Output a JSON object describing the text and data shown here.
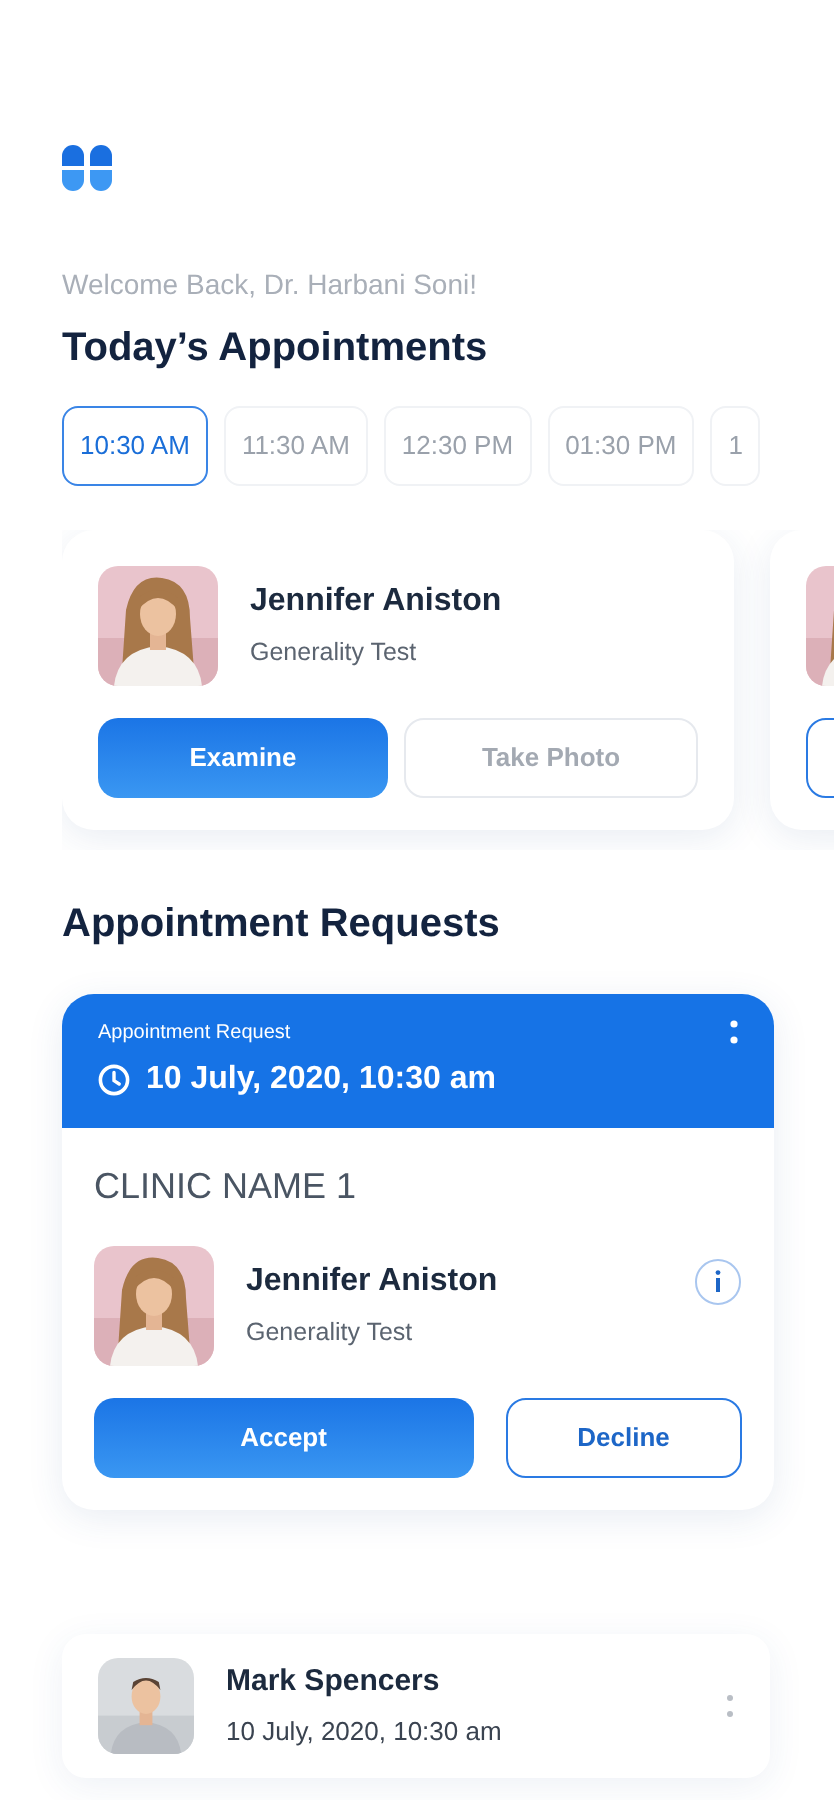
{
  "greeting": "Welcome Back, Dr. Harbani Soni!",
  "todays_title": "Today’s Appointments",
  "time_slots": [
    {
      "label": "10:30 AM",
      "selected": true
    },
    {
      "label": "11:30 AM",
      "selected": false
    },
    {
      "label": "12:30 PM",
      "selected": false
    },
    {
      "label": "01:30 PM",
      "selected": false
    },
    {
      "label": "1",
      "selected": false
    }
  ],
  "appointments": [
    {
      "photo": {
        "kind": "picture"
      },
      "name": "Jennifer Aniston",
      "test": "Generality Test",
      "buttons": [
        {
          "label": "Examine",
          "kind": "primary",
          "disabled": false
        },
        {
          "label": "Take Photo",
          "kind": "outline",
          "disabled": true
        }
      ]
    },
    {
      "photo": {
        "kind": "picture"
      },
      "buttons": [
        {
          "kind": "outline",
          "disabled": false
        }
      ]
    }
  ],
  "requests_title": "Appointment Requests",
  "request": {
    "header_label": "Appointment Request",
    "datetime": "10 July, 2020, 10:30 am",
    "clinic": "CLINIC NAME 1",
    "photo": {
      "kind": "picture"
    },
    "name": "Jennifer Aniston",
    "test": "Generality Test",
    "buttons": [
      {
        "label": "Accept",
        "kind": "primary",
        "disabled": false
      },
      {
        "label": "Decline",
        "kind": "outline",
        "disabled": false
      }
    ]
  },
  "past": [
    {
      "photo": {
        "kind": "picture"
      },
      "name": "Mark Spencers",
      "datetime": "10 July, 2020, 10:30 am"
    }
  ]
}
